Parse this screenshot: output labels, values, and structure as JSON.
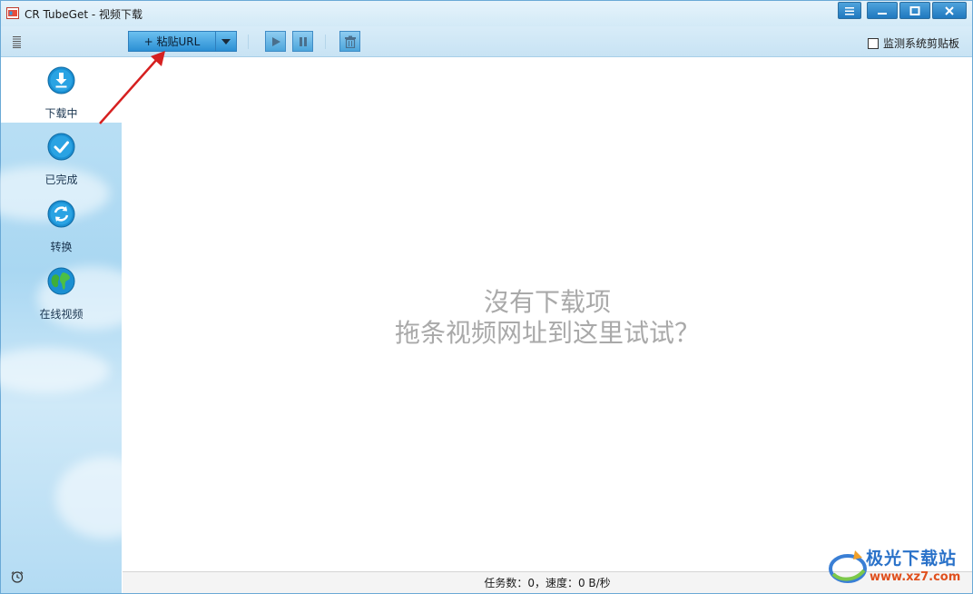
{
  "window": {
    "title": "CR TubeGet - 视频下载"
  },
  "toolbar": {
    "paste_label": "+ 粘贴URL",
    "monitor_clipboard_label": "监测系统剪贴板",
    "monitor_clipboard_checked": false
  },
  "sidebar": {
    "items": [
      {
        "label": "下载中",
        "icon": "download-icon",
        "active": true
      },
      {
        "label": "已完成",
        "icon": "check-icon",
        "active": false
      },
      {
        "label": "转换",
        "icon": "convert-icon",
        "active": false
      },
      {
        "label": "在线视频",
        "icon": "globe-icon",
        "active": false
      }
    ]
  },
  "main": {
    "empty_line1": "沒有下载项",
    "empty_line2": "拖条视频网址到这里试试？"
  },
  "status": {
    "text": "任务数：0，速度：0 B/秒"
  },
  "watermark": {
    "name": "极光下载站",
    "url": "www.xz7.com"
  },
  "colors": {
    "accent": "#2b8fd4",
    "sidebar": "#b3dbf3",
    "empty_text": "#a9a9a9",
    "annotation_arrow": "#d62020"
  }
}
